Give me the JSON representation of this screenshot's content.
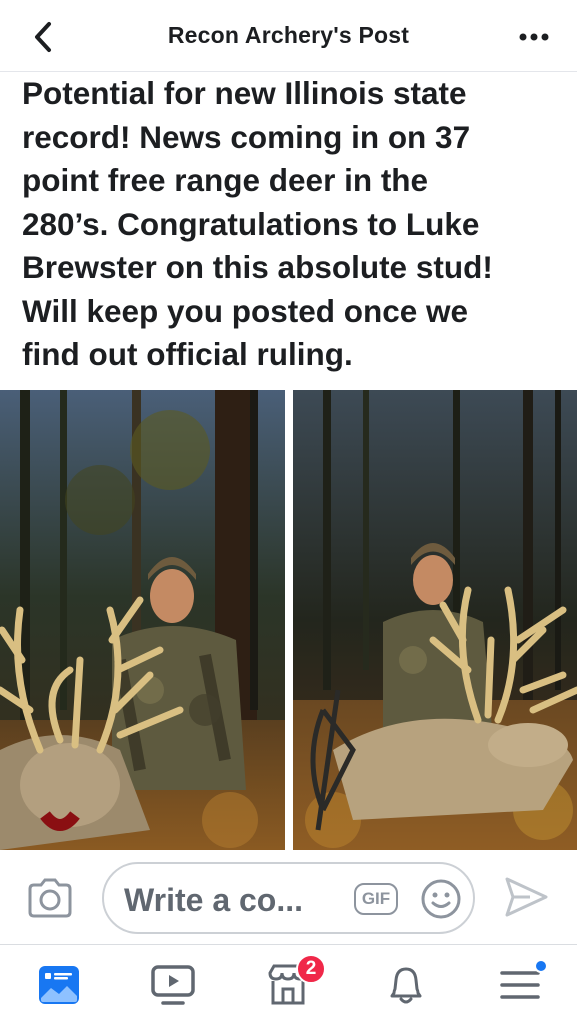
{
  "header": {
    "title": "Recon Archery's Post",
    "back_icon": "chevron-left-icon",
    "more_icon": "more-horizontal-icon"
  },
  "post": {
    "text_lines": [
      "Potential for new Illinois state",
      "record! News coming in on 37",
      "point free range deer in the",
      "280’s. Congratulations to Luke",
      "Brewster on this absolute stud!",
      "Will keep you posted once we",
      "find out official ruling."
    ],
    "photos": [
      "hunter-with-deer-photo",
      "hunter-with-deer-and-bow-photo"
    ]
  },
  "comment_bar": {
    "placeholder": "Write a co...",
    "gif_label": "GIF",
    "camera_icon": "camera-icon",
    "emoji_icon": "smiley-icon",
    "send_icon": "send-icon"
  },
  "bottom_nav": {
    "items": [
      {
        "name": "news-feed",
        "icon": "news-feed-icon",
        "active": true
      },
      {
        "name": "watch",
        "icon": "watch-icon",
        "active": false
      },
      {
        "name": "marketplace",
        "icon": "marketplace-icon",
        "active": false,
        "badge": "2"
      },
      {
        "name": "notifications",
        "icon": "bell-icon",
        "active": false
      },
      {
        "name": "menu",
        "icon": "menu-icon",
        "active": false,
        "dot": true
      }
    ]
  },
  "colors": {
    "accent": "#1877f2",
    "badge": "#f02849",
    "text": "#1c1e21",
    "muted": "#606770"
  }
}
